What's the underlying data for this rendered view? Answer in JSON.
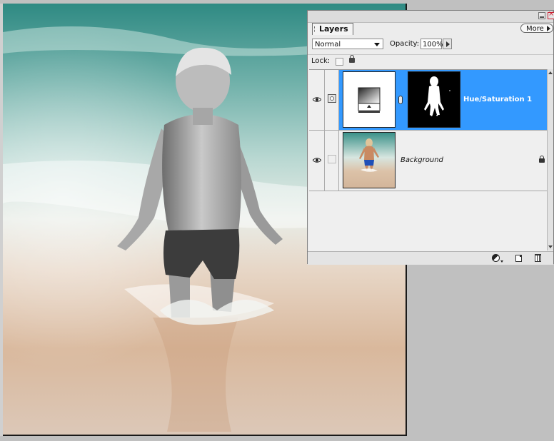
{
  "canvas": {
    "subject": "boy-in-water-photo"
  },
  "palette": {
    "tab_label": "Layers",
    "more_label": "More",
    "blend_mode": "Normal",
    "opacity_label": "Opacity:",
    "opacity_value": "100%",
    "lock_label": "Lock:"
  },
  "layers": [
    {
      "name": "Hue/Saturation 1",
      "visible": true,
      "selected": true,
      "has_mask": true,
      "thumb_icon": "adjustment-gradient-icon",
      "mask_icon": "boy-silhouette-mask"
    },
    {
      "name": "Background",
      "visible": true,
      "selected": false,
      "locked": true,
      "thumb_icon": "photo-thumbnail"
    }
  ],
  "colors": {
    "selection": "#3399ff",
    "panel": "#ececec",
    "workspace": "#c0c0c0"
  },
  "icons": {
    "visibility": "eye-icon",
    "lock": "lock-icon",
    "adjustment": "adjustment-layer-icon",
    "new_layer": "new-layer-icon",
    "trash": "trash-icon"
  }
}
